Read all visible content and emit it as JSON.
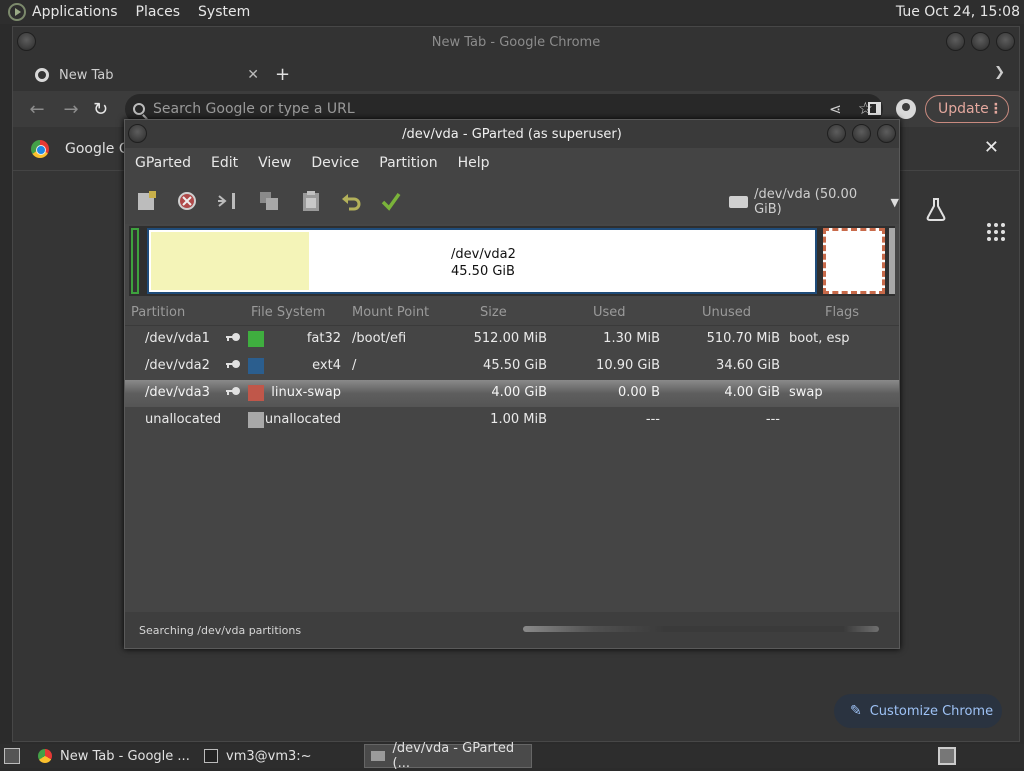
{
  "topbar": {
    "menus": [
      "Applications",
      "Places",
      "System"
    ],
    "clock": "Tue Oct 24, 15:08"
  },
  "chrome": {
    "window_title": "New Tab - Google Chrome",
    "tab_title": "New Tab",
    "new_tab_glyph": "+",
    "omnibox_placeholder": "Search Google or type a URL",
    "update_label": "Update",
    "infobar_text": "Google C",
    "customize_label": "Customize Chrome"
  },
  "gparted": {
    "window_title": "/dev/vda - GParted (as superuser)",
    "menu": [
      "GParted",
      "Edit",
      "View",
      "Device",
      "Partition",
      "Help"
    ],
    "device_selector": "/dev/vda (50.00 GiB)",
    "graph": {
      "name": "/dev/vda2",
      "size": "45.50 GiB"
    },
    "columns": [
      "Partition",
      "File System",
      "Mount Point",
      "Size",
      "Used",
      "Unused",
      "Flags"
    ],
    "rows": [
      {
        "partition": "/dev/vda1",
        "filesystem": "fat32",
        "mount": "/boot/efi",
        "size": "512.00 MiB",
        "used": "1.30 MiB",
        "unused": "510.70 MiB",
        "flags": "boot, esp",
        "color": "#3fae3f"
      },
      {
        "partition": "/dev/vda2",
        "filesystem": "ext4",
        "mount": "/",
        "size": "45.50 GiB",
        "used": "10.90 GiB",
        "unused": "34.60 GiB",
        "flags": "",
        "color": "#2b5e8e"
      },
      {
        "partition": "/dev/vda3",
        "filesystem": "linux-swap",
        "mount": "",
        "size": "4.00 GiB",
        "used": "0.00 B",
        "unused": "4.00 GiB",
        "flags": "swap",
        "color": "#c0574a"
      },
      {
        "partition": "unallocated",
        "filesystem": "unallocated",
        "mount": "",
        "size": "1.00 MiB",
        "used": "---",
        "unused": "---",
        "flags": "",
        "color": "#a8a8a8"
      }
    ],
    "status_text": "Searching /dev/vda partitions"
  },
  "taskbar": {
    "items": [
      "New Tab - Google ...",
      "vm3@vm3:~",
      "/dev/vda - GParted (..."
    ]
  },
  "colors": {
    "accent": "#9ec2f5",
    "update": "#e4a89e"
  }
}
